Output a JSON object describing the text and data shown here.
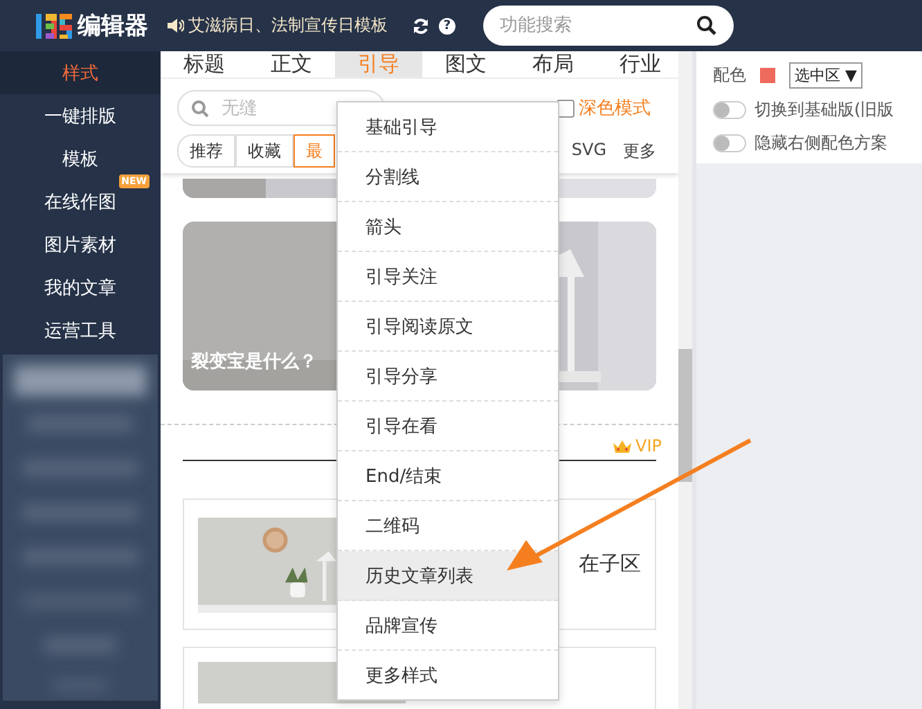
{
  "header": {
    "logo_text": "编辑器",
    "notice": "艾滋病日、法制宣传日模板",
    "help": "?",
    "search": {
      "placeholder": "功能搜索"
    }
  },
  "sidebar": {
    "items": [
      {
        "label": "样式",
        "selected": true
      },
      {
        "label": "一键排版",
        "selected": false
      },
      {
        "label": "模板",
        "selected": false
      },
      {
        "label": "在线作图",
        "selected": false,
        "badge": "NEW"
      },
      {
        "label": "图片素材",
        "selected": false
      },
      {
        "label": "我的文章",
        "selected": false
      },
      {
        "label": "运营工具",
        "selected": false
      }
    ]
  },
  "category_tabs": [
    {
      "label": "标题",
      "selected": false
    },
    {
      "label": "正文",
      "selected": false
    },
    {
      "label": "引导",
      "selected": true
    },
    {
      "label": "图文",
      "selected": false
    },
    {
      "label": "布局",
      "selected": false
    },
    {
      "label": "行业",
      "selected": false
    }
  ],
  "search": {
    "placeholder": "无缝"
  },
  "dark_mode": {
    "label": "深色模式",
    "checked": false
  },
  "filter_tabs": [
    {
      "label": "推荐",
      "selected": false
    },
    {
      "label": "收藏",
      "selected": false
    },
    {
      "label": "最",
      "selected": true
    }
  ],
  "filter_links": [
    "SVG",
    "更多"
  ],
  "content": {
    "caption": "裂变宝是什么？",
    "vip_label": "VIP",
    "card_text": "在子区"
  },
  "dropdown": {
    "items": [
      {
        "label": "基础引导",
        "selected": false
      },
      {
        "label": "分割线",
        "selected": false
      },
      {
        "label": "箭头",
        "selected": false
      },
      {
        "label": "引导关注",
        "selected": false
      },
      {
        "label": "引导阅读原文",
        "selected": false
      },
      {
        "label": "引导分享",
        "selected": false
      },
      {
        "label": "引导在看",
        "selected": false
      },
      {
        "label": "End/结束",
        "selected": false
      },
      {
        "label": "二维码",
        "selected": false
      },
      {
        "label": "历史文章列表",
        "selected": true
      },
      {
        "label": "品牌宣传",
        "selected": false
      },
      {
        "label": "更多样式",
        "selected": false
      }
    ]
  },
  "color_panel": {
    "label": "配色",
    "scope": "选中区",
    "scope_arrow": "▼",
    "toggles": [
      {
        "label": "切换到基础版(旧版",
        "on": false
      },
      {
        "label": "隐藏右侧配色方案",
        "on": false
      }
    ]
  }
}
